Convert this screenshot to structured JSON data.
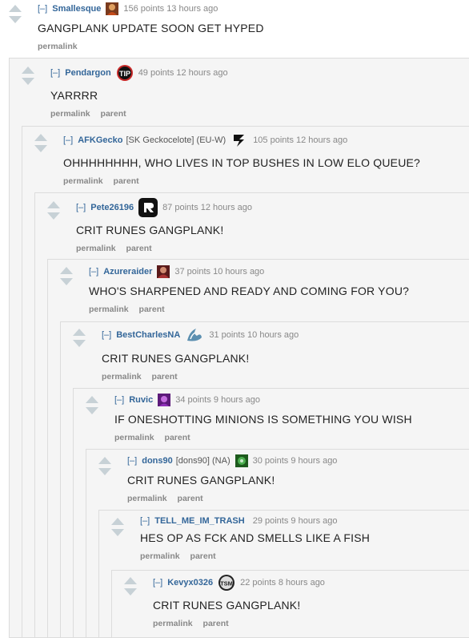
{
  "collapse_label": "[–]",
  "permalink_label": "permalink",
  "parent_label": "parent",
  "comments": [
    {
      "author": "Smallesque",
      "flair": "",
      "icon": "champion-portrait-icon",
      "score": "156 points 13 hours ago",
      "text": "GANGPLANK UPDATE SOON GET HYPED",
      "buttons": [
        "permalink"
      ]
    },
    {
      "author": "Pendargon",
      "flair": "",
      "icon": "team-logo-icon",
      "score": "49 points 12 hours ago",
      "text": "YARRRR",
      "buttons": [
        "permalink",
        "parent"
      ]
    },
    {
      "author": "AFKGecko",
      "flair": "[SK Geckocelote] (EU-W)",
      "icon": "sk-gaming-logo-icon",
      "score": "105 points 12 hours ago",
      "text": "OHHHHHHHH, WHO LIVES IN TOP BUSHES IN LOW ELO QUEUE?",
      "buttons": [
        "permalink",
        "parent"
      ]
    },
    {
      "author": "Pete26196",
      "flair": "",
      "icon": "team-logo-icon",
      "score": "87 points 12 hours ago",
      "text": "CRIT RUNES GANGPLANK!",
      "buttons": [
        "permalink",
        "parent"
      ]
    },
    {
      "author": "Azureraider",
      "flair": "",
      "icon": "champion-portrait-icon",
      "score": "37 points 10 hours ago",
      "text": "WHO'S SHARPENED AND READY AND COMING FOR YOU?",
      "buttons": [
        "permalink",
        "parent"
      ]
    },
    {
      "author": "BestCharlesNA",
      "flair": "",
      "icon": "team-liquid-logo-icon",
      "score": "31 points 10 hours ago",
      "text": "CRIT RUNES GANGPLANK!",
      "buttons": [
        "permalink",
        "parent"
      ]
    },
    {
      "author": "Ruvic",
      "flair": "",
      "icon": "champion-portrait-icon",
      "score": "34 points 9 hours ago",
      "text": "IF ONESHOTTING MINIONS IS SOMETHING YOU WISH",
      "buttons": [
        "permalink",
        "parent"
      ]
    },
    {
      "author": "dons90",
      "flair": "[dons90] (NA)",
      "icon": "champion-portrait-icon",
      "score": "30 points 9 hours ago",
      "text": "CRIT RUNES GANGPLANK!",
      "buttons": [
        "permalink",
        "parent"
      ]
    },
    {
      "author": "TELL_ME_IM_TRASH",
      "flair": "",
      "icon": "",
      "score": "29 points 9 hours ago",
      "text": "HES OP AS FCK AND SMELLS LIKE A FISH",
      "buttons": [
        "permalink",
        "parent"
      ]
    },
    {
      "author": "Kevyx0326",
      "flair": "",
      "icon": "team-solomid-logo-icon",
      "score": "22 points 8 hours ago",
      "text": "CRIT RUNES GANGPLANK!",
      "buttons": [
        "permalink",
        "parent"
      ]
    }
  ]
}
